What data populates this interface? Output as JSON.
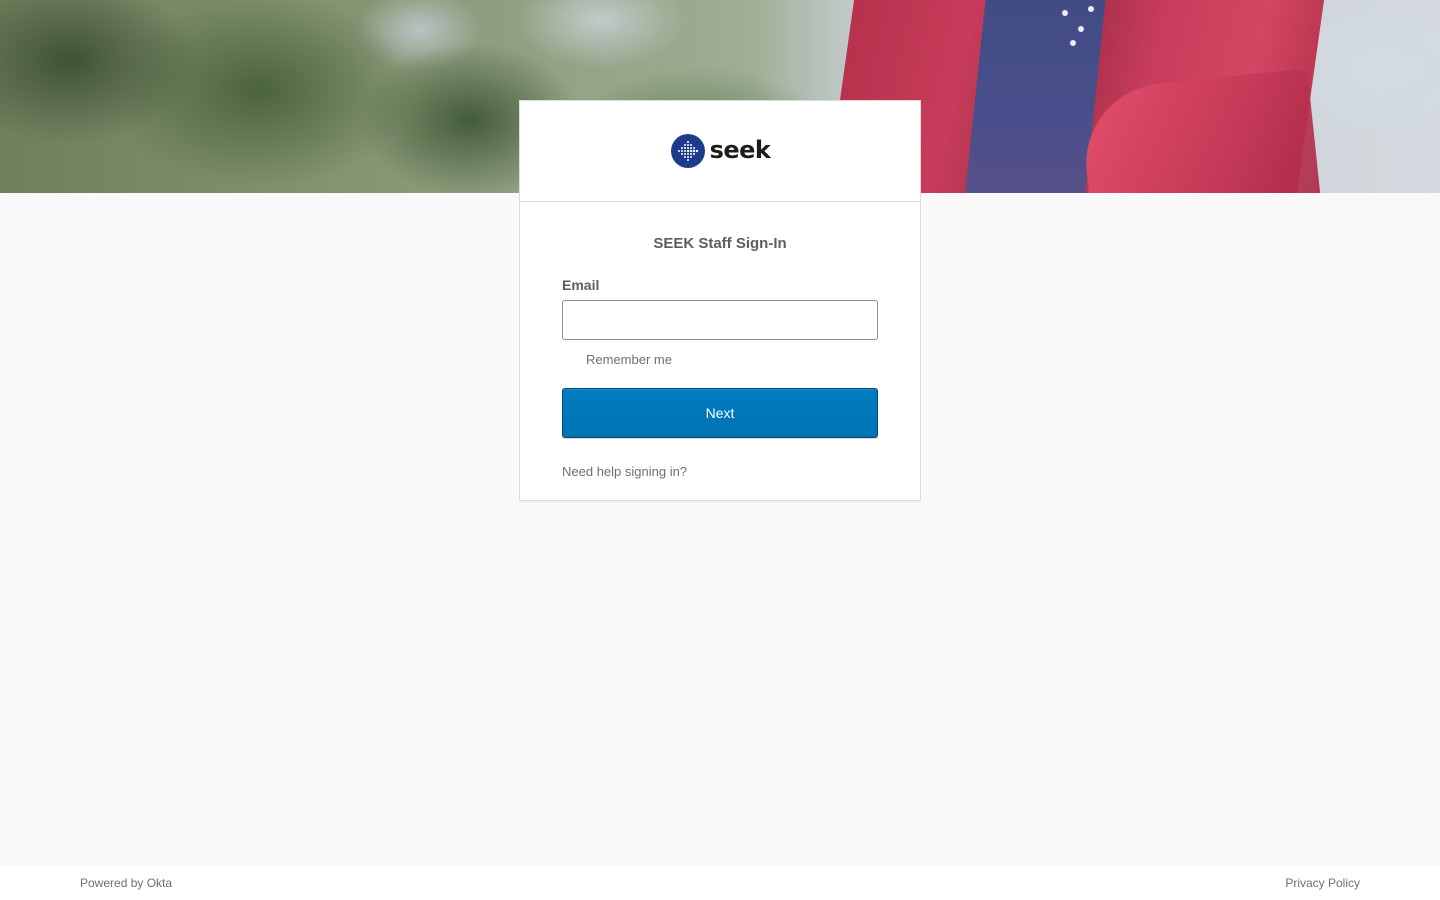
{
  "brand": {
    "logo_text": "seek",
    "colors": {
      "logo_circle": "#1e3a8a",
      "primary_button": "#007dc1"
    }
  },
  "signin": {
    "title": "SEEK Staff Sign-In",
    "email_label": "Email",
    "email_value": "",
    "email_placeholder": "",
    "remember_label": "Remember me",
    "remember_checked": false,
    "next_label": "Next",
    "help_link": "Need help signing in?"
  },
  "footer": {
    "powered_by": "Powered by Okta",
    "privacy": "Privacy Policy"
  }
}
